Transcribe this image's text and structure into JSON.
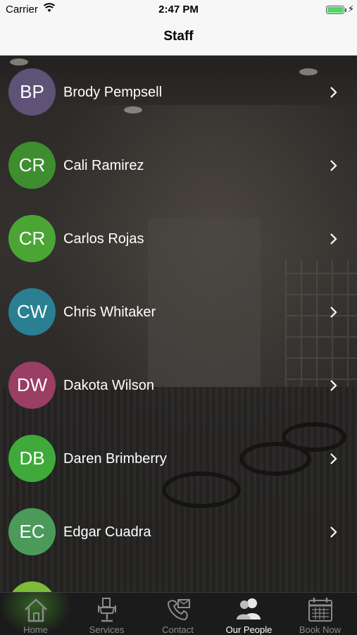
{
  "status_bar": {
    "carrier": "Carrier",
    "time": "2:47 PM"
  },
  "nav": {
    "title": "Staff"
  },
  "staff": [
    {
      "initials": "BP",
      "name": "Brody Pempsell",
      "color": "#5f5277"
    },
    {
      "initials": "CR",
      "name": "Cali Ramirez",
      "color": "#3e8d2e"
    },
    {
      "initials": "CR",
      "name": "Carlos Rojas",
      "color": "#4aa535"
    },
    {
      "initials": "CW",
      "name": "Chris Whitaker",
      "color": "#2a7f93"
    },
    {
      "initials": "DW",
      "name": "Dakota Wilson",
      "color": "#9a3e63"
    },
    {
      "initials": "DB",
      "name": "Daren Brimberry",
      "color": "#3faa3a"
    },
    {
      "initials": "EC",
      "name": "Edgar Cuadra",
      "color": "#4c9a5a"
    },
    {
      "initials": "",
      "name": "",
      "color": "#7dbb3a"
    }
  ],
  "tabs": [
    {
      "label": "Home",
      "icon": "home-icon"
    },
    {
      "label": "Services",
      "icon": "barber-chair-icon"
    },
    {
      "label": "Contact",
      "icon": "contact-icon"
    },
    {
      "label": "Our People",
      "icon": "people-icon",
      "active": true
    },
    {
      "label": "Book Now",
      "icon": "calendar-icon"
    }
  ]
}
